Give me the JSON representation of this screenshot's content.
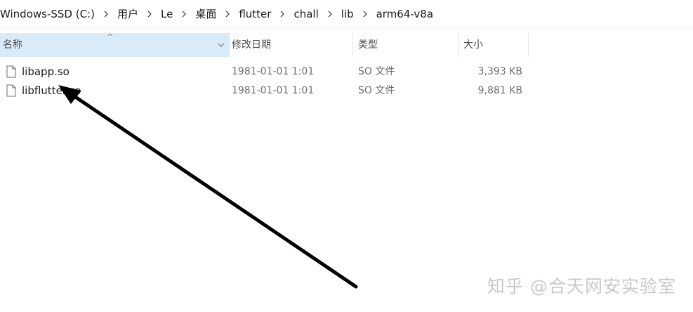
{
  "breadcrumb": {
    "items": [
      {
        "label": "Windows-SSD (C:)"
      },
      {
        "label": "用户"
      },
      {
        "label": "Le"
      },
      {
        "label": "桌面"
      },
      {
        "label": "flutter"
      },
      {
        "label": "chall"
      },
      {
        "label": "lib"
      },
      {
        "label": "arm64-v8a"
      }
    ]
  },
  "columns": {
    "name": "名称",
    "date": "修改日期",
    "type": "类型",
    "size": "大小"
  },
  "sort": {
    "column": "name",
    "direction": "ascending",
    "indicator": "^"
  },
  "files": [
    {
      "name": "libapp.so",
      "date": "1981-01-01 1:01",
      "type": "SO 文件",
      "size": "3,393 KB",
      "icon": "file-icon"
    },
    {
      "name": "libflutter.so",
      "date": "1981-01-01 1:01",
      "type": "SO 文件",
      "size": "9,881 KB",
      "icon": "file-icon"
    }
  ],
  "watermark": "知乎 @合天网安实验室",
  "colors": {
    "header_selected_bg": "#d9ebf9",
    "arrow": "#000000",
    "secondary_text": "#6d6d6d"
  }
}
